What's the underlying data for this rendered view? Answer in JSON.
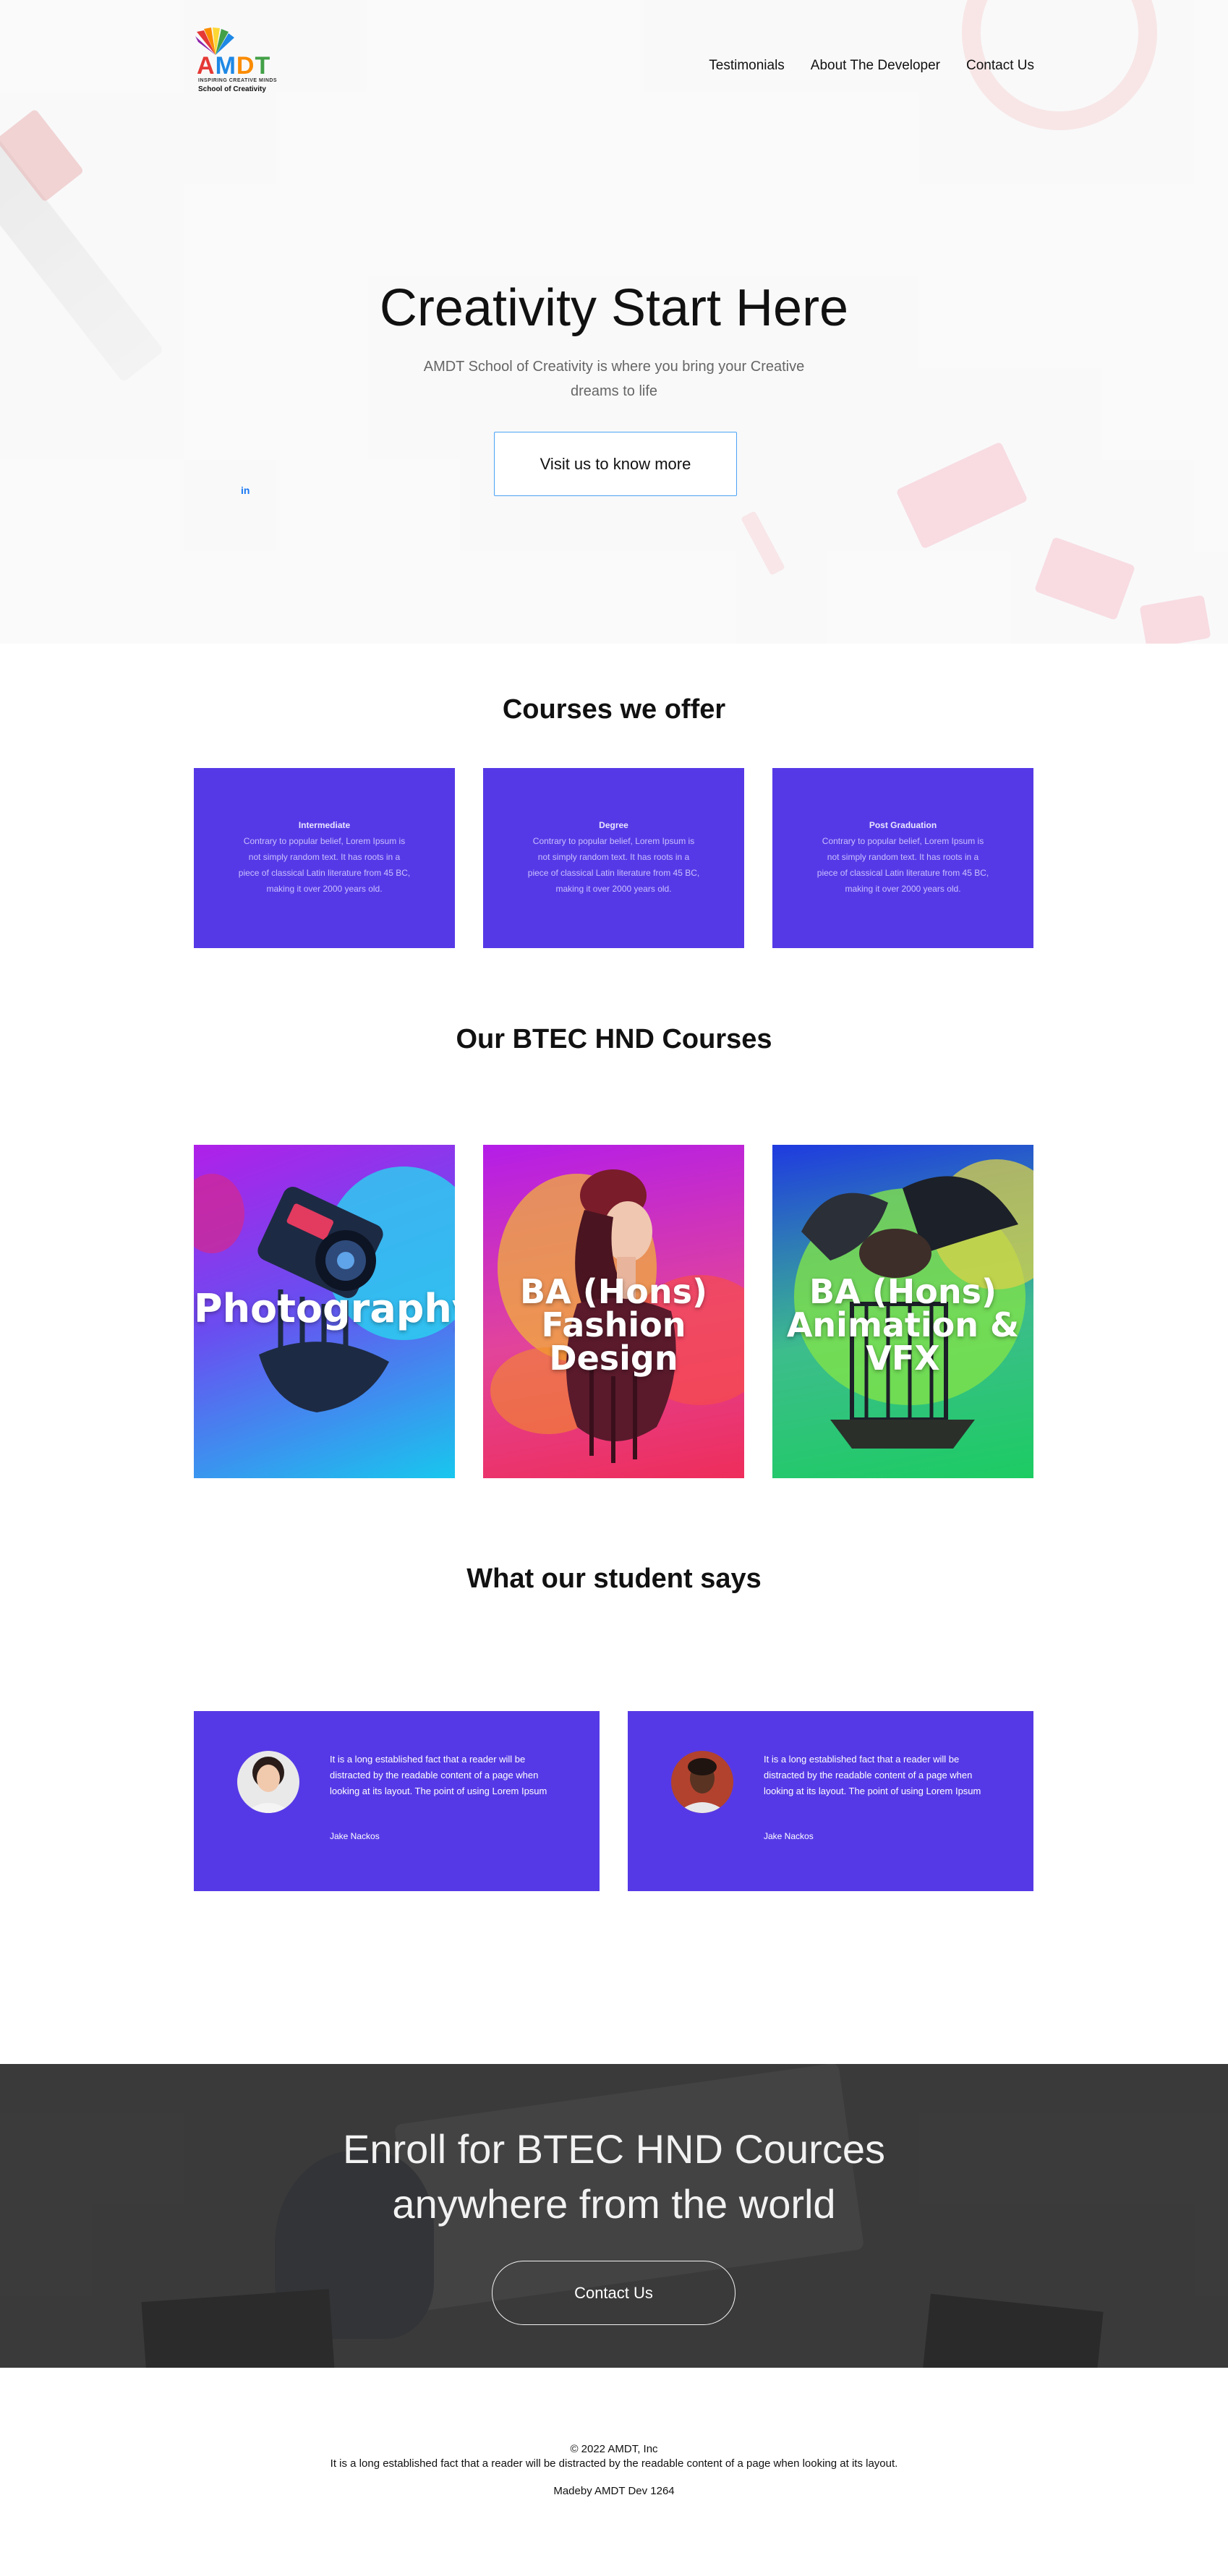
{
  "brand": {
    "logo_letters": [
      "A",
      "M",
      "D",
      "T"
    ],
    "tagline": "INSPIRING CREATIVE MINDS",
    "subtitle": "School of Creativity"
  },
  "nav": {
    "items": [
      {
        "label": "Testimonials"
      },
      {
        "label": "About The Developer"
      },
      {
        "label": "Contact Us"
      }
    ]
  },
  "hero": {
    "title": "Creativity Start Here",
    "subtitle": "AMDT School of Creativity is where you bring your Creative dreams to life",
    "cta_label": "Visit us to know more",
    "social_icon": "linkedin-icon",
    "social_label": "in"
  },
  "courses": {
    "title": "Courses we offer",
    "items": [
      {
        "name": "Intermediate",
        "desc": "Contrary to popular belief, Lorem Ipsum is not simply random text. It has roots in a piece of classical Latin literature from 45 BC, making it over 2000 years old."
      },
      {
        "name": "Degree",
        "desc": "Contrary to popular belief, Lorem Ipsum is not simply random text. It has roots in a piece of classical Latin literature from 45 BC, making it over 2000 years old."
      },
      {
        "name": "Post Graduation",
        "desc": "Contrary to popular belief, Lorem Ipsum is not simply random text. It has roots in a piece of classical Latin literature from 45 BC, making it over 2000 years old."
      }
    ]
  },
  "btec": {
    "title": "Our BTEC HND Courses",
    "items": [
      {
        "line1": "Photography",
        "line2": ""
      },
      {
        "line1": "BA (Hons)",
        "line2": "Fashion Design"
      },
      {
        "line1": "BA (Hons)",
        "line2": "Animation & VFX"
      }
    ]
  },
  "testimonials": {
    "title": "What our student says",
    "items": [
      {
        "quote": "It is a long established fact that a reader will be distracted by the readable content of a page when looking at its layout. The point of using Lorem Ipsum",
        "author": "Jake Nackos"
      },
      {
        "quote": "It is a long established fact that a reader will be distracted by the readable content of a page when looking at its layout. The point of using Lorem Ipsum",
        "author": "Jake Nackos"
      }
    ]
  },
  "enroll": {
    "line1": "Enroll for BTEC HND Cources",
    "line2": "anywhere from the world",
    "cta_label": "Contact Us"
  },
  "footer": {
    "copyright": "© 2022 AMDT, Inc",
    "text": "It is a long established fact that a reader will be distracted by the readable content of a page when looking at its layout.",
    "credit": "Madeby AMDT Dev 1264"
  },
  "colors": {
    "card_purple": "#5639e6",
    "hero_button_border": "#4aa3f5",
    "linkedin_blue": "#1877f2"
  }
}
